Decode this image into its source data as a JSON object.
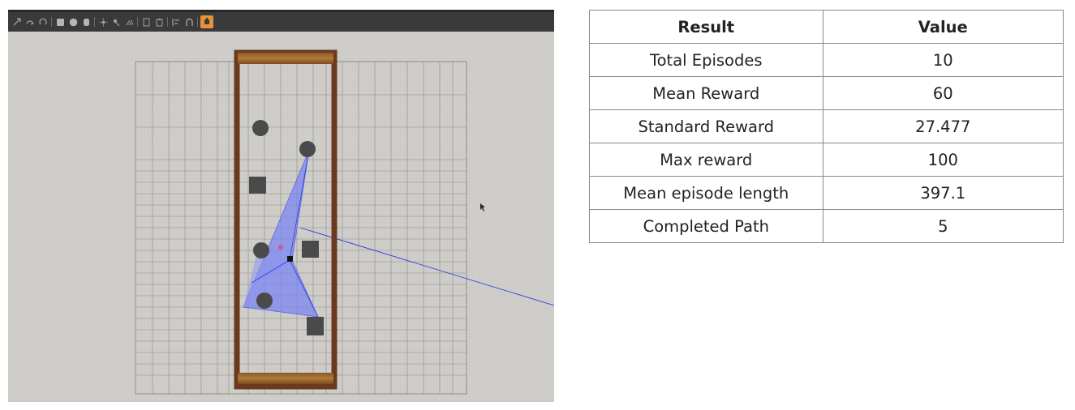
{
  "simulator": {
    "toolbar": {
      "icons": [
        "arrow-select-icon",
        "pointer-icon",
        "box-icon",
        "sphere-icon",
        "cylinder-icon",
        "point-light-icon",
        "spot-light-icon",
        "directional-light-icon",
        "copy-icon",
        "paste-icon",
        "align-icon",
        "snap-icon",
        "record-icon"
      ]
    },
    "colors": {
      "floor": "#cfcdc9",
      "wall": "#6b3a1e",
      "wall_end": "#9c6a2e",
      "obstacle": "#4a4a4a",
      "laser_fan": "#7b86f0",
      "laser_ray": "#2f3fe0",
      "goal_marker": "#c75b9a"
    }
  },
  "results_table": {
    "headers": [
      "Result",
      "Value"
    ],
    "rows": [
      {
        "label": "Total Episodes",
        "value": "10"
      },
      {
        "label": "Mean Reward",
        "value": "60"
      },
      {
        "label": "Standard Reward",
        "value": "27.477"
      },
      {
        "label": "Max reward",
        "value": "100"
      },
      {
        "label": "Mean episode length",
        "value": "397.1"
      },
      {
        "label": "Completed Path",
        "value": "5"
      }
    ]
  }
}
